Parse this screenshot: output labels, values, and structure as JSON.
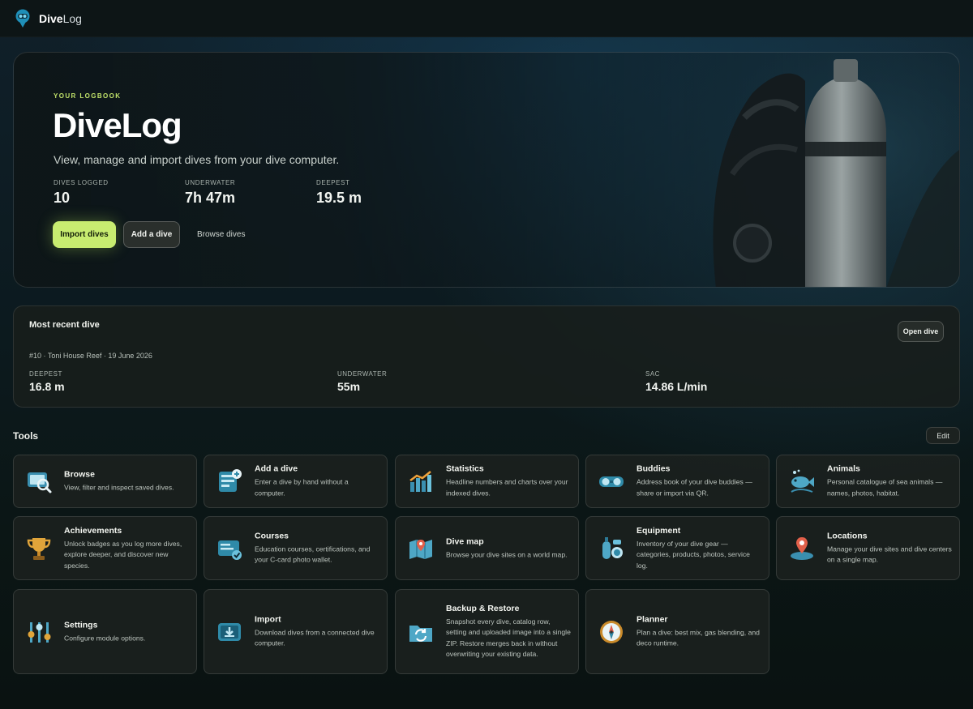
{
  "app": {
    "brand_bold": "Dive",
    "brand_light": "Log"
  },
  "hero": {
    "eyebrow": "YOUR LOGBOOK",
    "title": "DiveLog",
    "subtitle": "View, manage and import dives from your dive computer.",
    "stats": [
      {
        "label": "DIVES LOGGED",
        "value": "10"
      },
      {
        "label": "UNDERWATER",
        "value": "7h 47m"
      },
      {
        "label": "DEEPEST",
        "value": "19.5 m"
      }
    ],
    "actions": {
      "import": "Import dives",
      "add": "Add a dive",
      "browse": "Browse dives"
    }
  },
  "recent": {
    "title": "Most recent dive",
    "open_label": "Open dive",
    "meta": "#10 · Toni House Reef · 19 June 2026",
    "stats": [
      {
        "label": "DEEPEST",
        "value": "16.8 m"
      },
      {
        "label": "UNDERWATER",
        "value": "55m"
      },
      {
        "label": "SAC",
        "value": "14.86 L/min"
      }
    ]
  },
  "tools": {
    "title": "Tools",
    "edit_label": "Edit",
    "items": [
      {
        "name": "Browse",
        "desc": "View, filter and inspect saved dives.",
        "icon": "browse-icon"
      },
      {
        "name": "Add a dive",
        "desc": "Enter a dive by hand without a computer.",
        "icon": "add-dive-icon"
      },
      {
        "name": "Statistics",
        "desc": "Headline numbers and charts over your indexed dives.",
        "icon": "statistics-icon"
      },
      {
        "name": "Buddies",
        "desc": "Address book of your dive buddies — share or import via QR.",
        "icon": "buddies-icon"
      },
      {
        "name": "Animals",
        "desc": "Personal catalogue of sea animals — names, photos, habitat.",
        "icon": "animals-icon"
      },
      {
        "name": "Achievements",
        "desc": "Unlock badges as you log more dives, explore deeper, and discover new species.",
        "icon": "trophy-icon"
      },
      {
        "name": "Courses",
        "desc": "Education courses, certifications, and your C-card photo wallet.",
        "icon": "courses-icon"
      },
      {
        "name": "Dive map",
        "desc": "Browse your dive sites on a world map.",
        "icon": "map-icon"
      },
      {
        "name": "Equipment",
        "desc": "Inventory of your dive gear — categories, products, photos, service log.",
        "icon": "equipment-icon"
      },
      {
        "name": "Locations",
        "desc": "Manage your dive sites and dive centers on a single map.",
        "icon": "location-pin-icon"
      },
      {
        "name": "Settings",
        "desc": "Configure module options.",
        "icon": "settings-sliders-icon"
      },
      {
        "name": "Import",
        "desc": "Download dives from a connected dive computer.",
        "icon": "import-icon"
      },
      {
        "name": "Backup & Restore",
        "desc": "Snapshot every dive, catalog row, setting and uploaded image into a single ZIP. Restore merges back in without overwriting your existing data.",
        "icon": "backup-icon"
      },
      {
        "name": "Planner",
        "desc": "Plan a dive: best mix, gas blending, and deco runtime.",
        "icon": "compass-icon"
      }
    ]
  }
}
